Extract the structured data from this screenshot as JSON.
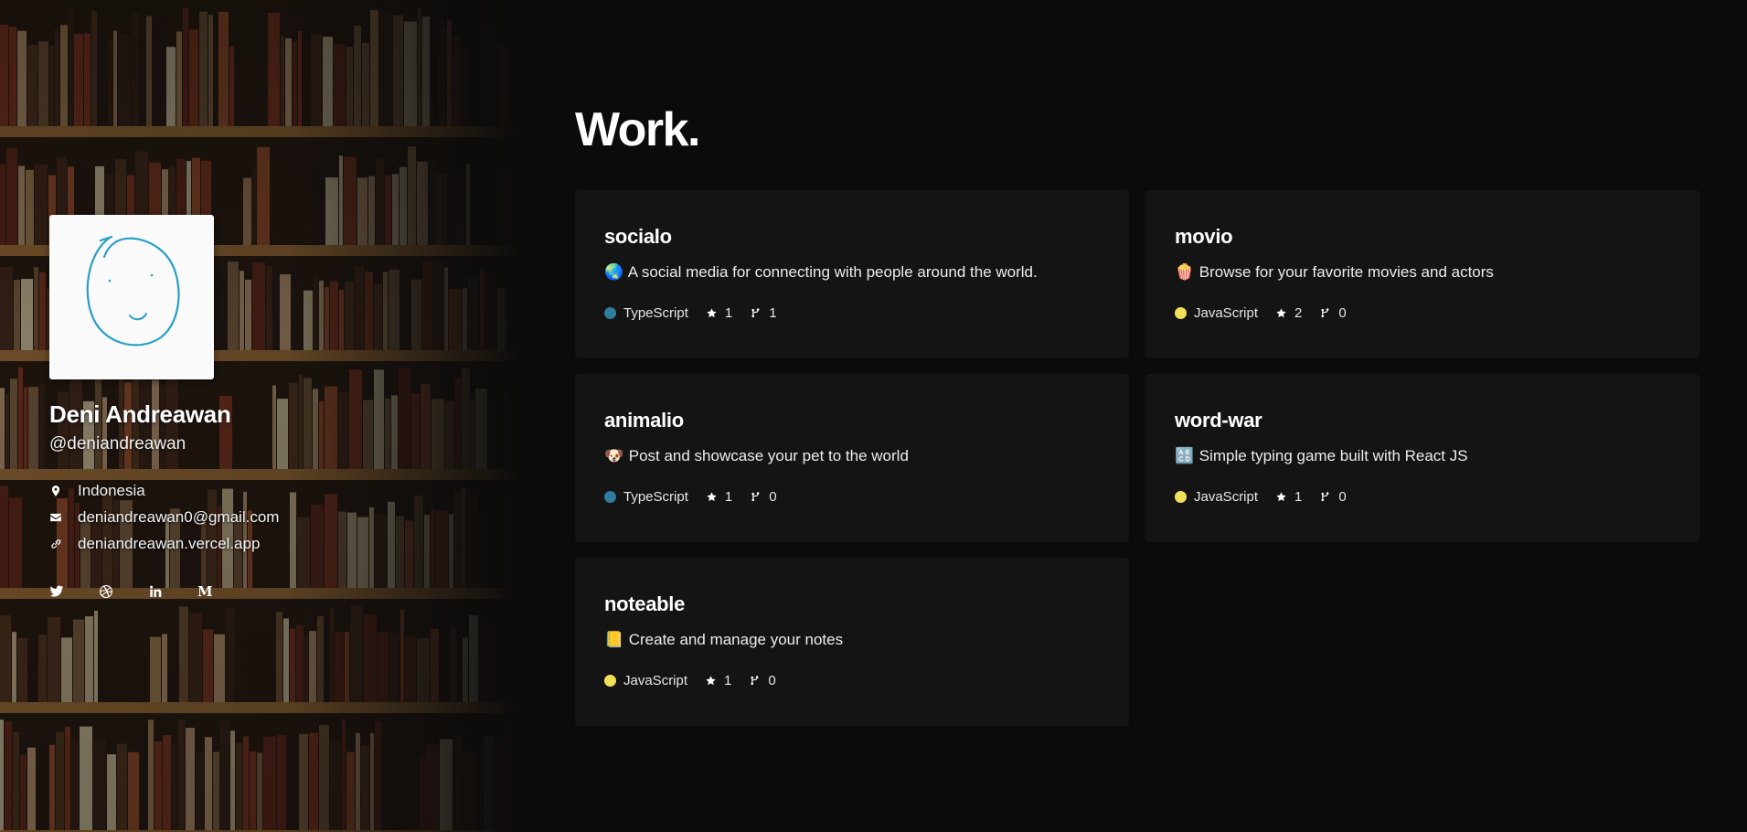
{
  "profile": {
    "name": "Deni Andreawan",
    "handle": "@deniandreawan",
    "location": "Indonesia",
    "email": "deniandreawan0@gmail.com",
    "website": "deniandreawan.vercel.app",
    "avatar_icon": "hand-drawn-smiley-avatar",
    "background": "bookshelf-photo"
  },
  "icons": {
    "location": "map-pin-icon",
    "email": "envelope-icon",
    "website": "link-icon"
  },
  "socials": [
    {
      "name": "twitter",
      "icon": "twitter-icon"
    },
    {
      "name": "dribbble",
      "icon": "dribbble-icon"
    },
    {
      "name": "linkedin",
      "icon": "linkedin-icon"
    },
    {
      "name": "medium",
      "icon": "medium-icon",
      "glyph": "M"
    }
  ],
  "main": {
    "title": "Work."
  },
  "repos": [
    {
      "name": "socialo",
      "emoji": "🌏",
      "description": "A social media for connecting with people around the world.",
      "language": "TypeScript",
      "lang_color": "#2f7c9c",
      "stars": "1",
      "forks": "1"
    },
    {
      "name": "movio",
      "emoji": "🍿",
      "description": "Browse for your favorite movies and actors",
      "language": "JavaScript",
      "lang_color": "#f1e05a",
      "stars": "2",
      "forks": "0"
    },
    {
      "name": "animalio",
      "emoji": "🐶",
      "description": "Post and showcase your pet to the world",
      "language": "TypeScript",
      "lang_color": "#2f7c9c",
      "stars": "1",
      "forks": "0"
    },
    {
      "name": "word-war",
      "emoji": "🔠",
      "description": "Simple typing game built with React JS",
      "language": "JavaScript",
      "lang_color": "#f1e05a",
      "stars": "1",
      "forks": "0"
    },
    {
      "name": "noteable",
      "emoji": "📒",
      "description": "Create and manage your notes",
      "language": "JavaScript",
      "lang_color": "#f1e05a",
      "stars": "1",
      "forks": "0"
    }
  ]
}
